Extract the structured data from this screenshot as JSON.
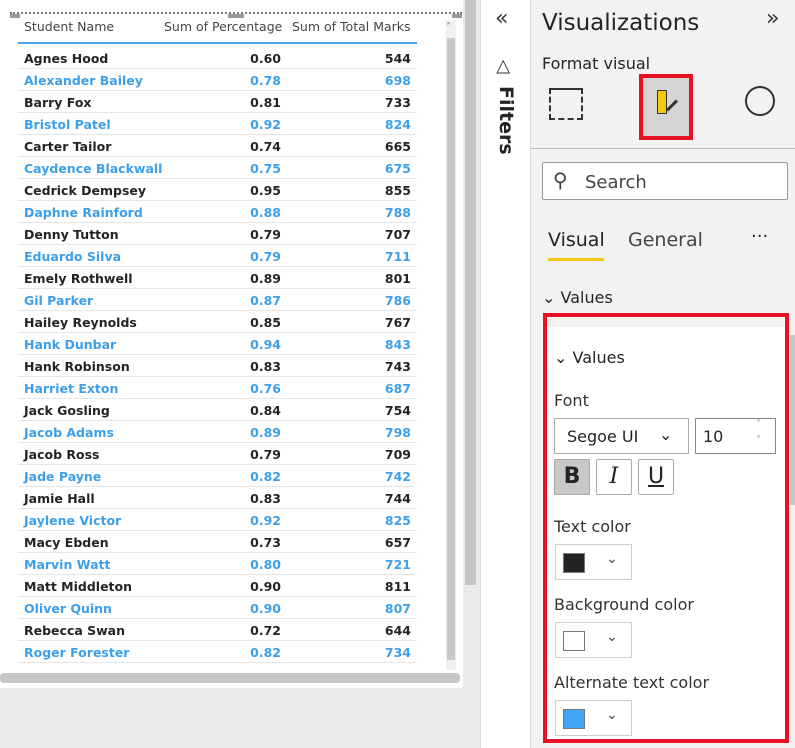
{
  "table": {
    "headers": [
      "Student Name",
      "Sum of Percentage",
      "Sum of Total Marks"
    ],
    "rows": [
      [
        "Agnes Hood",
        "0.60",
        "544"
      ],
      [
        "Alexander Bailey",
        "0.78",
        "698"
      ],
      [
        "Barry Fox",
        "0.81",
        "733"
      ],
      [
        "Bristol Patel",
        "0.92",
        "824"
      ],
      [
        "Carter Tailor",
        "0.74",
        "665"
      ],
      [
        "Caydence Blackwall",
        "0.75",
        "675"
      ],
      [
        "Cedrick Dempsey",
        "0.95",
        "855"
      ],
      [
        "Daphne Rainford",
        "0.88",
        "788"
      ],
      [
        "Denny Tutton",
        "0.79",
        "707"
      ],
      [
        "Eduardo Silva",
        "0.79",
        "711"
      ],
      [
        "Emely Rothwell",
        "0.89",
        "801"
      ],
      [
        "Gil Parker",
        "0.87",
        "786"
      ],
      [
        "Hailey Reynolds",
        "0.85",
        "767"
      ],
      [
        "Hank Dunbar",
        "0.94",
        "843"
      ],
      [
        "Hank Robinson",
        "0.83",
        "743"
      ],
      [
        "Harriet Exton",
        "0.76",
        "687"
      ],
      [
        "Jack Gosling",
        "0.84",
        "754"
      ],
      [
        "Jacob Adams",
        "0.89",
        "798"
      ],
      [
        "Jacob Ross",
        "0.79",
        "709"
      ],
      [
        "Jade Payne",
        "0.82",
        "742"
      ],
      [
        "Jamie Hall",
        "0.83",
        "744"
      ],
      [
        "Jaylene Victor",
        "0.92",
        "825"
      ],
      [
        "Macy Ebden",
        "0.73",
        "657"
      ],
      [
        "Marvin Watt",
        "0.80",
        "721"
      ],
      [
        "Matt Middleton",
        "0.90",
        "811"
      ],
      [
        "Oliver Quinn",
        "0.90",
        "807"
      ],
      [
        "Rebecca Swan",
        "0.72",
        "644"
      ],
      [
        "Roger Forester",
        "0.82",
        "734"
      ]
    ]
  },
  "filters": {
    "label": "Filters"
  },
  "viz": {
    "title": "Visualizations",
    "subtitle": "Format visual",
    "search_placeholder": "Search",
    "tabs": [
      "Visual",
      "General"
    ],
    "more": "···",
    "section": "Values",
    "subsection": "Values",
    "font_label": "Font",
    "font_value": "Segoe UI",
    "size_value": "10",
    "bold": "B",
    "italic": "I",
    "underline": "U",
    "text_color_label": "Text color",
    "text_color": "#252423",
    "bg_color_label": "Background color",
    "bg_color": "#ffffff",
    "alt_text_color_label": "Alternate text color",
    "alt_text_color": "#41a4f4",
    "highlight_color": "#e81123",
    "accent": "#f2c811"
  }
}
